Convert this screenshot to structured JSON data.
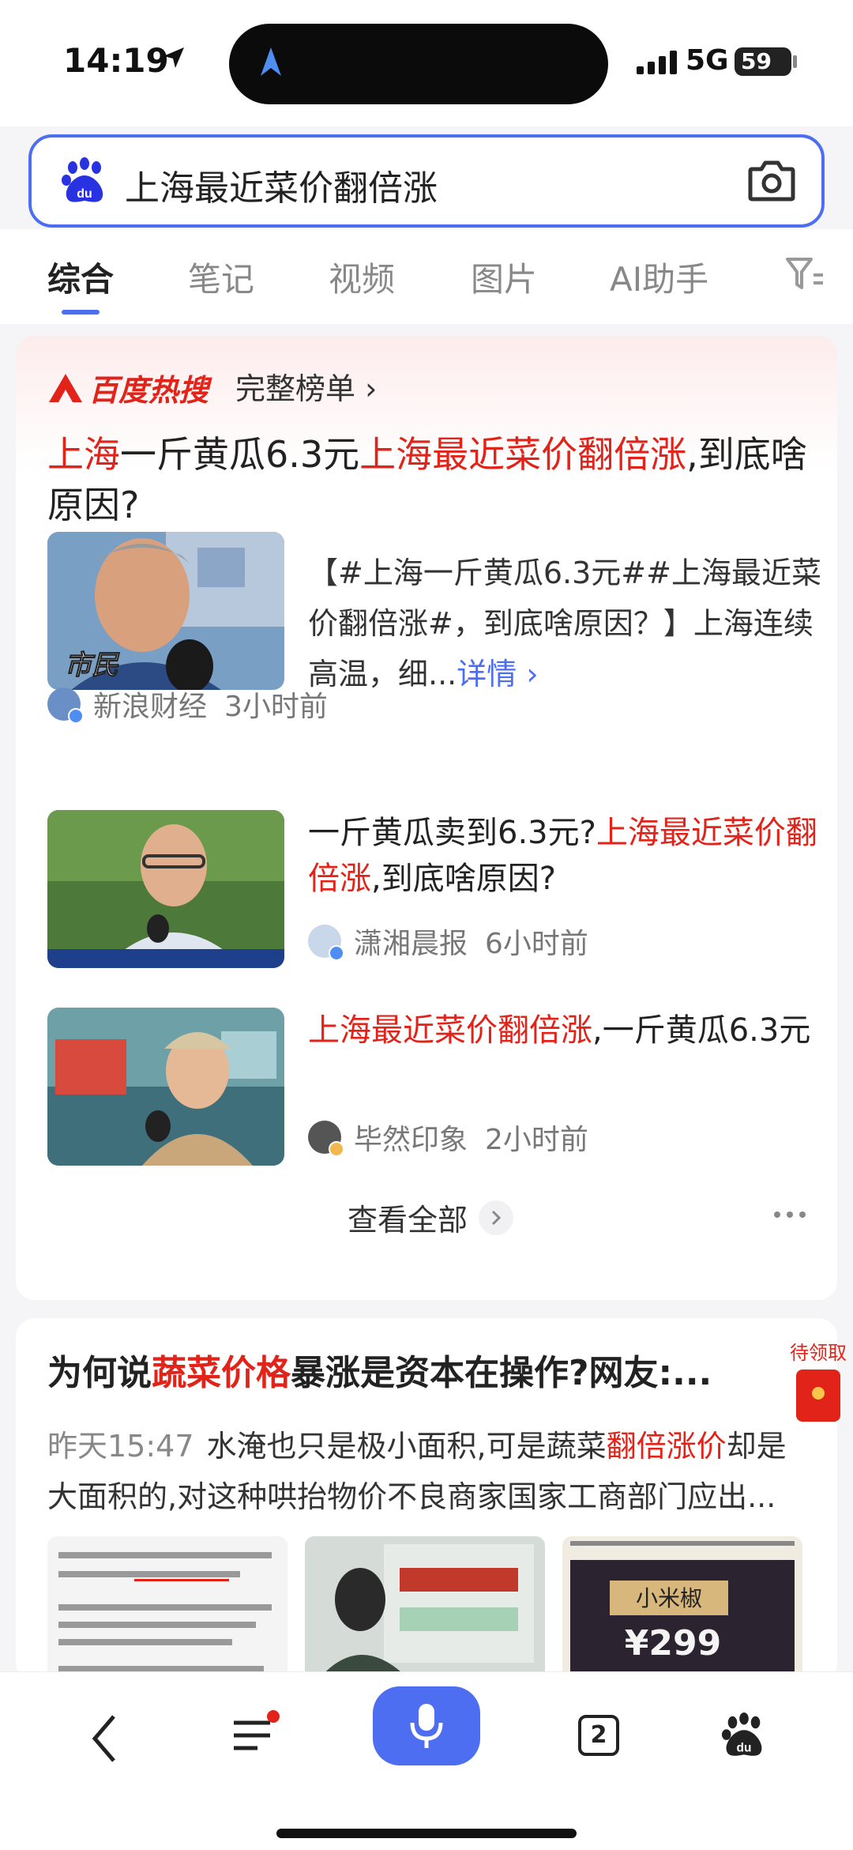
{
  "status": {
    "time": "14:19",
    "network": "5G",
    "battery": "59"
  },
  "search": {
    "query": "上海最近菜价翻倍涨"
  },
  "tabs": [
    "综合",
    "笔记",
    "视频",
    "图片",
    "AI助手"
  ],
  "hot": {
    "brand": "百度热搜",
    "link": "完整榜单 ›",
    "headline_parts": [
      "上海",
      "一斤黄瓜6.3元",
      "上海最近菜价翻倍涨",
      ",到底啥原因?"
    ],
    "desc": "【#上海一斤黄瓜6.3元##上海最近菜价翻倍涨#，到底啥原因？】上海连续高温，细...",
    "desc_more": "详情 ›",
    "thumb_caption": "市民",
    "source": "新浪财经",
    "source_time": "3小时前"
  },
  "items": [
    {
      "title_parts": [
        "一斤黄瓜卖到6.3元?",
        "上海最近菜价翻倍涨",
        ",到底啥原因?"
      ],
      "source": "潇湘晨报",
      "time": "6小时前"
    },
    {
      "title_parts": [
        "上海最近菜价翻倍涨",
        ",一斤黄瓜6.3元"
      ],
      "source": "毕然印象",
      "time": "2小时前"
    }
  ],
  "view_all": "查看全部",
  "card2": {
    "title_parts": [
      "为何说",
      "蔬菜价格",
      "暴涨是资本在操作?网友:..."
    ],
    "time": "昨天15:47",
    "body_parts": [
      "水淹也只是极小面积,可是蔬菜",
      "翻倍涨价",
      "却是大面积的,对这种哄抬物价不良商家国家工商部门应出..."
    ],
    "redpack_label": "待领取",
    "img3_label": "小米椒",
    "img3_price": "¥299"
  },
  "bottom": {
    "tab_count": "2"
  },
  "colors": {
    "accent": "#4e6ef2",
    "highlight": "#e2231a"
  }
}
